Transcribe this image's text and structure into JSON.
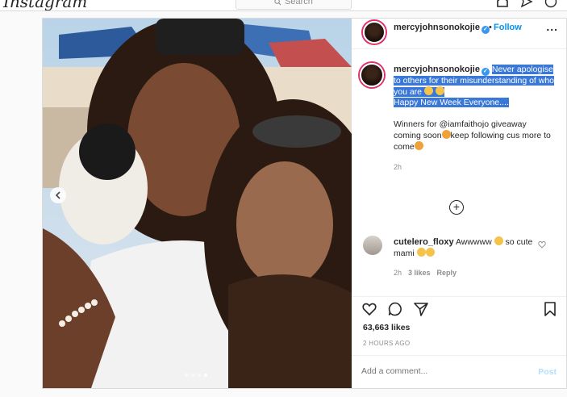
{
  "topbar": {
    "logo": "Instagram",
    "search_placeholder": "Search"
  },
  "post": {
    "username": "mercyjohnsonokojie",
    "follow_label": "Follow",
    "bullet": "•",
    "more_label": "...",
    "caption_line1": "Never apologise to others for their misunderstanding of who you are",
    "caption_line2": "Happy New Week Everyone....",
    "caption_line3": "Winners for @iamfaithojo giveaway coming soon",
    "caption_line3b": "keep following cus more to come",
    "caption_time": "2h",
    "comment": {
      "username": "cutelero_floxy",
      "text": "Awwwww",
      "text2": "so cute mami",
      "time": "2h",
      "likes": "3 likes",
      "reply": "Reply"
    },
    "likes": "63,663 likes",
    "posted_ago": "2 HOURS AGO",
    "add_comment_placeholder": "Add a comment...",
    "post_label": "Post"
  },
  "carousel": {
    "current": 4,
    "total": 4
  },
  "colors": {
    "accent": "#0095f6",
    "selection": "#3a78d8",
    "muted": "#8e8e8e"
  }
}
